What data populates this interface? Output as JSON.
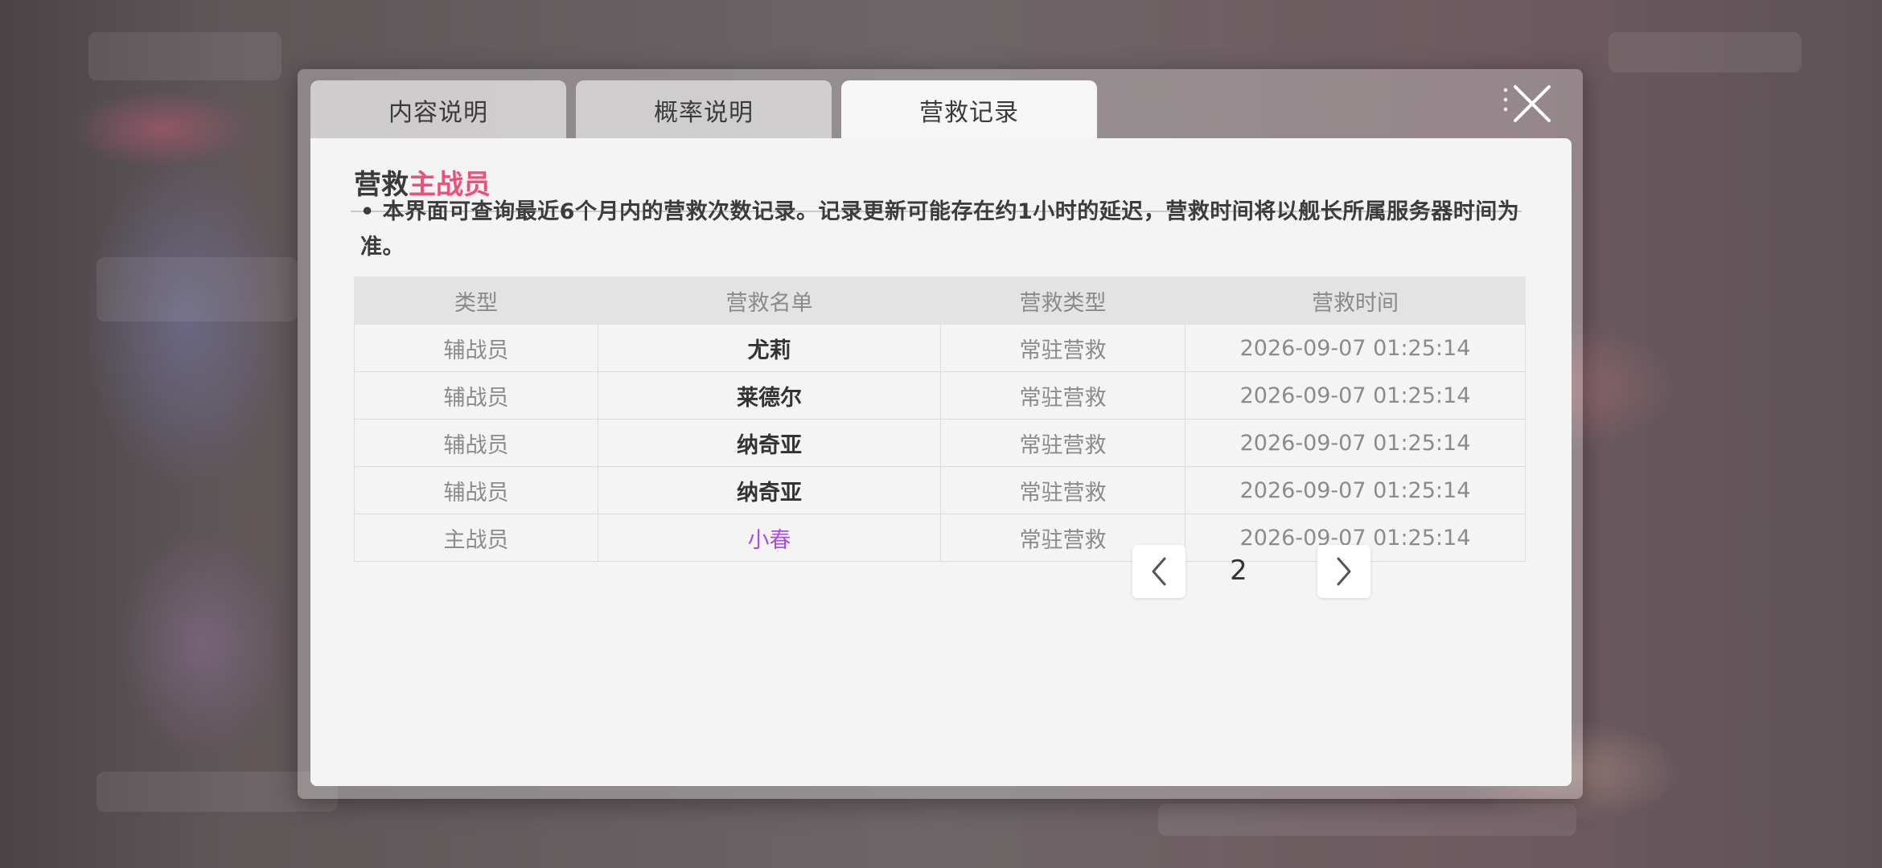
{
  "tabs": [
    {
      "label": "内容说明",
      "active": false
    },
    {
      "label": "概率说明",
      "active": false
    },
    {
      "label": "营救记录",
      "active": true
    }
  ],
  "section": {
    "title_prefix": "营救",
    "title_highlight": "主战员"
  },
  "notice": "• 本界面可查询最近6个月内的营救次数记录。记录更新可能存在约1小时的延迟，营救时间将以舰长所属服务器时间为准。",
  "table": {
    "headers": [
      "类型",
      "营救名单",
      "营救类型",
      "营救时间"
    ],
    "rows": [
      [
        "辅战员",
        "尤莉",
        "常驻营救",
        "2026-09-07 01:25:14"
      ],
      [
        "辅战员",
        "莱德尔",
        "常驻营救",
        "2026-09-07 01:25:14"
      ],
      [
        "辅战员",
        "纳奇亚",
        "常驻营救",
        "2026-09-07 01:25:14"
      ],
      [
        "辅战员",
        "纳奇亚",
        "常驻营救",
        "2026-09-07 01:25:14"
      ],
      [
        "主战员",
        "小春",
        "常驻营救",
        "2026-09-07 01:25:14"
      ]
    ]
  },
  "pager": {
    "current_page": "2"
  },
  "icons": {
    "close": "close-icon",
    "prev": "chevron-left-icon",
    "next": "chevron-right-icon"
  },
  "colors": {
    "highlight": "#ef4f79",
    "featured_name": "#a64fe3",
    "panel": "#f4f4f4"
  }
}
